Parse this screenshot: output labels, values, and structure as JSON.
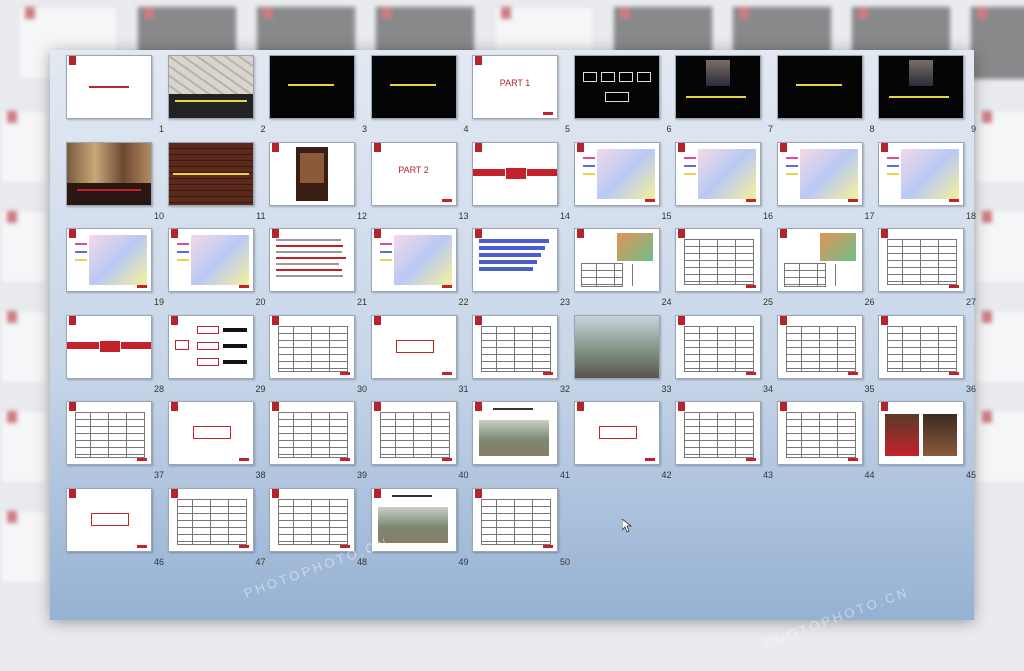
{
  "app": {
    "view": "slide-sorter"
  },
  "slides": [
    {
      "n": "1",
      "kind": "title"
    },
    {
      "n": "2",
      "kind": "map-dark"
    },
    {
      "n": "3",
      "kind": "black-text"
    },
    {
      "n": "4",
      "kind": "black-text"
    },
    {
      "n": "5",
      "kind": "part",
      "part": "PART 1"
    },
    {
      "n": "6",
      "kind": "black-chart"
    },
    {
      "n": "7",
      "kind": "black-photo"
    },
    {
      "n": "8",
      "kind": "black-text"
    },
    {
      "n": "9",
      "kind": "black-photo"
    },
    {
      "n": "10",
      "kind": "photo-street"
    },
    {
      "n": "11",
      "kind": "photo-wall"
    },
    {
      "n": "12",
      "kind": "photo-book"
    },
    {
      "n": "13",
      "kind": "part",
      "part": "PART 2"
    },
    {
      "n": "14",
      "kind": "redbar"
    },
    {
      "n": "15",
      "kind": "map"
    },
    {
      "n": "16",
      "kind": "map"
    },
    {
      "n": "17",
      "kind": "map"
    },
    {
      "n": "18",
      "kind": "map"
    },
    {
      "n": "19",
      "kind": "map"
    },
    {
      "n": "20",
      "kind": "map"
    },
    {
      "n": "21",
      "kind": "text-red"
    },
    {
      "n": "22",
      "kind": "map"
    },
    {
      "n": "23",
      "kind": "bars-blue"
    },
    {
      "n": "24",
      "kind": "map-table"
    },
    {
      "n": "25",
      "kind": "table"
    },
    {
      "n": "26",
      "kind": "map-table"
    },
    {
      "n": "27",
      "kind": "table"
    },
    {
      "n": "28",
      "kind": "redbar"
    },
    {
      "n": "29",
      "kind": "tree"
    },
    {
      "n": "30",
      "kind": "table"
    },
    {
      "n": "31",
      "kind": "box"
    },
    {
      "n": "32",
      "kind": "table"
    },
    {
      "n": "33",
      "kind": "photo-land"
    },
    {
      "n": "34",
      "kind": "table"
    },
    {
      "n": "35",
      "kind": "table"
    },
    {
      "n": "36",
      "kind": "table"
    },
    {
      "n": "37",
      "kind": "table"
    },
    {
      "n": "38",
      "kind": "box"
    },
    {
      "n": "39",
      "kind": "table"
    },
    {
      "n": "40",
      "kind": "table"
    },
    {
      "n": "41",
      "kind": "photo-site"
    },
    {
      "n": "42",
      "kind": "box"
    },
    {
      "n": "43",
      "kind": "table"
    },
    {
      "n": "44",
      "kind": "table"
    },
    {
      "n": "45",
      "kind": "photo-red"
    },
    {
      "n": "46",
      "kind": "box"
    },
    {
      "n": "47",
      "kind": "table"
    },
    {
      "n": "48",
      "kind": "table"
    },
    {
      "n": "49",
      "kind": "photo-site"
    },
    {
      "n": "50",
      "kind": "table"
    }
  ],
  "colors": {
    "accent": "#b5242a",
    "panel_top": "#e3e9f3",
    "panel_bottom": "#95b1d3"
  },
  "watermark": {
    "text": "PHOTOPHOTO.CN"
  }
}
